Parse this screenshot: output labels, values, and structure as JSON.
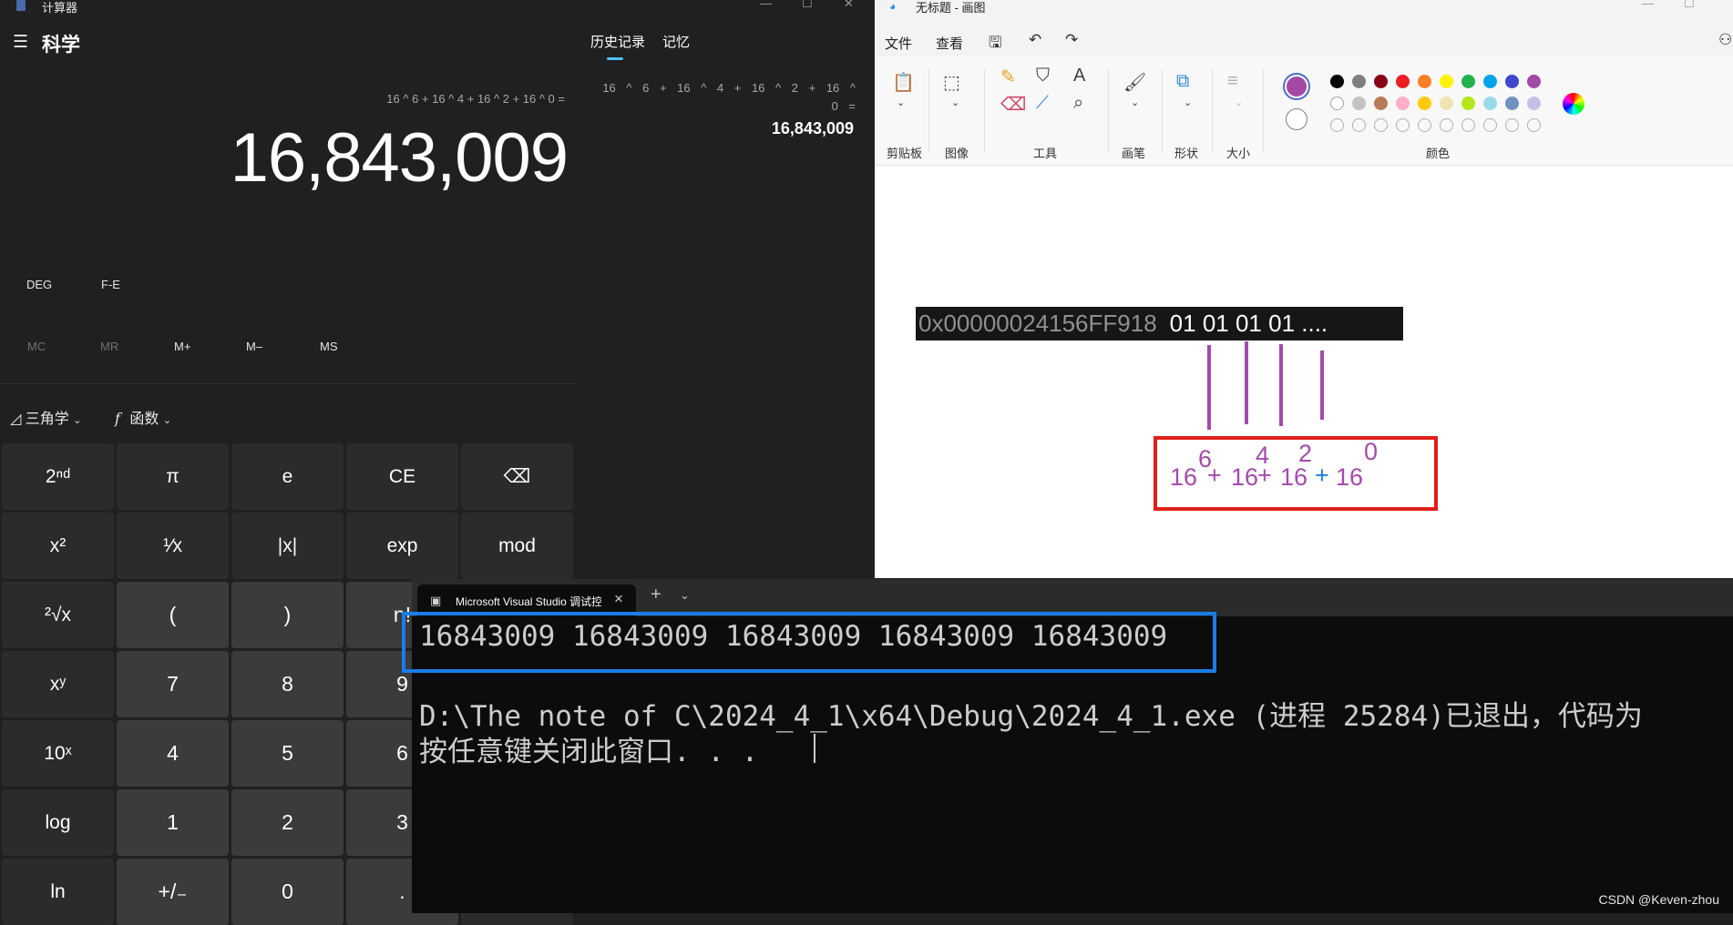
{
  "calculator": {
    "title": "计算器",
    "mode": "科学",
    "expression": "16 ^ 6 + 16 ^ 4 + 16 ^ 2 + 16 ^ 0 =",
    "result": "16,843,009",
    "tabs": [
      "历史记录",
      "记忆"
    ],
    "history": {
      "expression": "16 ^ 6 + 16 ^ 4 + 16 ^ 2 + 16 ^ 0 =",
      "result": "16,843,009"
    },
    "angle_buttons": [
      "DEG",
      "F-E"
    ],
    "memory_buttons": [
      "MC",
      "MR",
      "M+",
      "M–",
      "MS"
    ],
    "dropdowns": [
      "三角学",
      "函数"
    ],
    "keys": [
      [
        "2ⁿᵈ",
        "π",
        "e",
        "CE",
        "⌫"
      ],
      [
        "x²",
        "¹⁄x",
        "|x|",
        "exp",
        "mod"
      ],
      [
        "²√x",
        "(",
        ")",
        "n!",
        "÷"
      ],
      [
        "xʸ",
        "7",
        "8",
        "9",
        "×"
      ],
      [
        "10ˣ",
        "4",
        "5",
        "6",
        "−"
      ],
      [
        "log",
        "1",
        "2",
        "3",
        "+"
      ],
      [
        "ln",
        "+/₋",
        "0",
        ".",
        "="
      ]
    ]
  },
  "paint": {
    "title": "无标题 - 画图",
    "menu": [
      "文件",
      "查看"
    ],
    "ribbon_groups": [
      "剪贴板",
      "图像",
      "工具",
      "画笔",
      "形状",
      "大小",
      "颜色"
    ],
    "palette_colors": [
      "#000000",
      "#7f7f7f",
      "#880015",
      "#ed1c24",
      "#ff7f27",
      "#fff200",
      "#22b14c",
      "#00a2e8",
      "#3f48cc",
      "#a349a4",
      "#ffffff",
      "#c3c3c3",
      "#b97a57",
      "#ffaec9",
      "#ffc90e",
      "#efe4b0",
      "#b5e61d",
      "#99d9ea",
      "#7092be",
      "#c8bfe7"
    ],
    "primary_color": "#a349a4",
    "memory_address": "0x00000024156FF918",
    "memory_bytes": "01 01 01 01  ....",
    "exponents": [
      "6",
      "4",
      "2",
      "0"
    ],
    "bases": [
      "16",
      "+",
      "16",
      "+",
      "16",
      "+",
      "16"
    ]
  },
  "console": {
    "tab_title": "Microsoft Visual Studio 调试控制台",
    "output_line": "16843009 16843009 16843009 16843009 16843009",
    "exit_line": "D:\\The note of C\\2024_4_1\\x64\\Debug\\2024_4_1.exe (进程 25284)已退出，代码为",
    "prompt_line": "按任意键关闭此窗口. . ."
  },
  "watermark": "CSDN @Keven-zhou"
}
